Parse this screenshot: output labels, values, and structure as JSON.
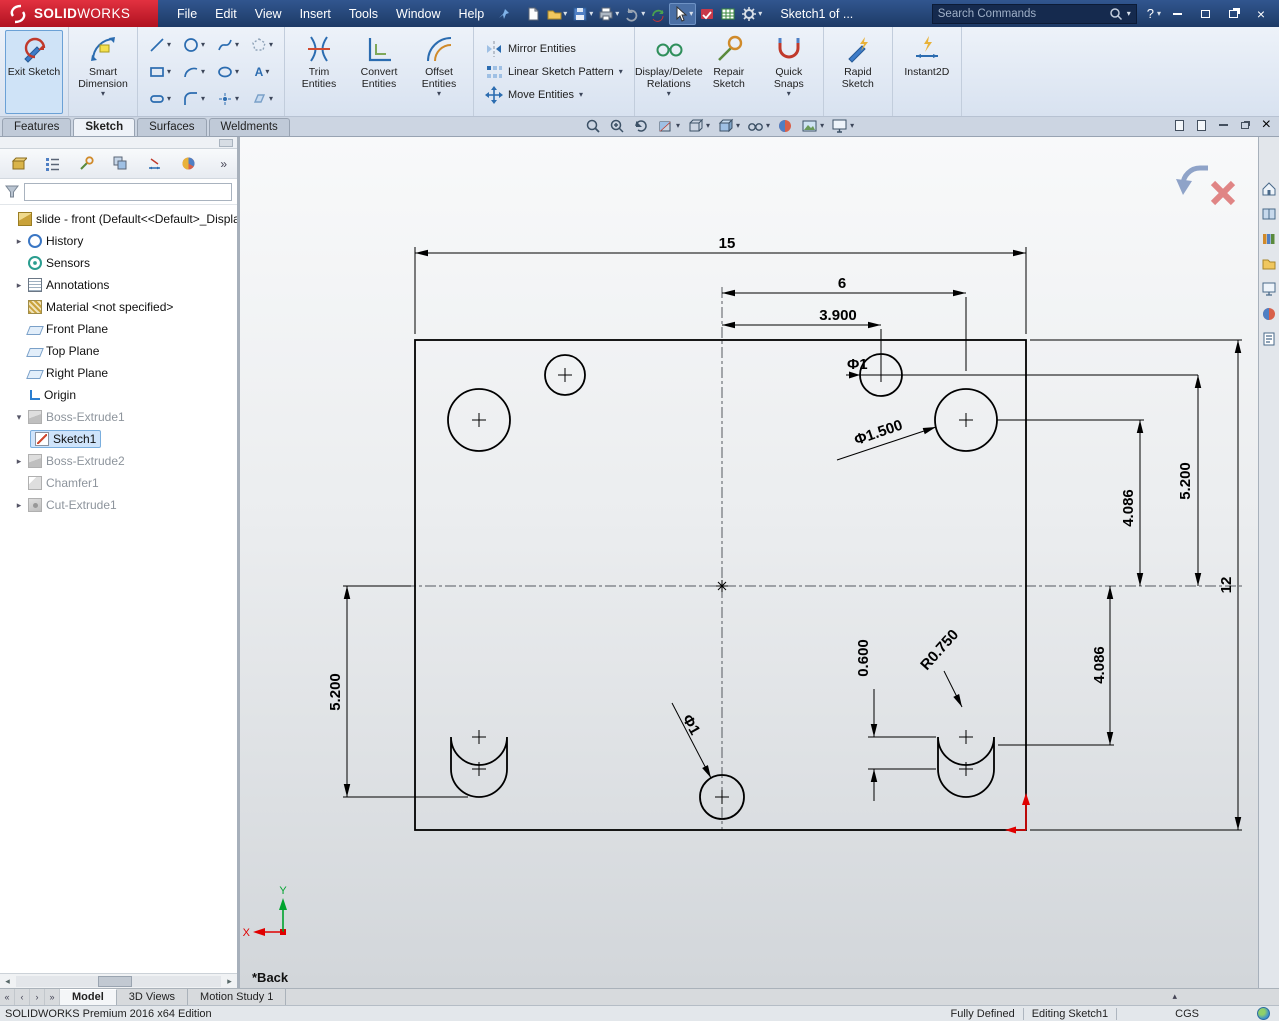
{
  "titlebar": {
    "logo_solid": "SOLID",
    "logo_works": "WORKS",
    "menus": [
      "File",
      "Edit",
      "View",
      "Insert",
      "Tools",
      "Window",
      "Help"
    ],
    "doc_title": "Sketch1 of ...",
    "search_placeholder": "Search Commands"
  },
  "ribbon": {
    "buttons": {
      "exit_sketch": "Exit Sketch",
      "smart_dimension": "Smart Dimension",
      "trim_entities": "Trim Entities",
      "convert_entities": "Convert Entities",
      "offset_entities": "Offset Entities",
      "mirror_entities": "Mirror Entities",
      "linear_pattern": "Linear Sketch Pattern",
      "move_entities": "Move Entities",
      "display_delete_relations": "Display/Delete Relations",
      "repair_sketch": "Repair Sketch",
      "quick_snaps": "Quick Snaps",
      "rapid_sketch": "Rapid Sketch",
      "instant2d": "Instant2D"
    }
  },
  "command_tabs": {
    "items": [
      "Features",
      "Sketch",
      "Surfaces",
      "Weldments"
    ],
    "active": "Sketch"
  },
  "feature_tree": {
    "root": "slide - front (Default<<Default>_Display",
    "filter_value": "",
    "items": [
      {
        "label": "History"
      },
      {
        "label": "Sensors"
      },
      {
        "label": "Annotations"
      },
      {
        "label": "Material <not specified>"
      },
      {
        "label": "Front Plane"
      },
      {
        "label": "Top Plane"
      },
      {
        "label": "Right Plane"
      },
      {
        "label": "Origin"
      },
      {
        "label": "Boss-Extrude1"
      },
      {
        "label": "Sketch1"
      },
      {
        "label": "Boss-Extrude2"
      },
      {
        "label": "Chamfer1"
      },
      {
        "label": "Cut-Extrude1"
      }
    ]
  },
  "sketch": {
    "view_label": "*Back",
    "triad": {
      "x": "X",
      "y": "Y"
    },
    "dims": {
      "overall_width": "15",
      "hole_spacing_6": "6",
      "hole_offset_3900": "3.900",
      "dia_1_top": "Φ1",
      "dia_1500": "Φ1.500",
      "right_5200": "5.200",
      "right_4086": "4.086",
      "overall_height": "12",
      "left_5200": "5.200",
      "dia_1_bottom": "Φ1",
      "slot_0600": "0.600",
      "radius_0750": "R0.750",
      "bottom_4086": "4.086"
    }
  },
  "bottom_tabs": {
    "items": [
      "Model",
      "3D Views",
      "Motion Study 1"
    ],
    "active": "Model"
  },
  "statusbar": {
    "edition": "SOLIDWORKS Premium 2016 x64 Edition",
    "defined_state": "Fully Defined",
    "editing": "Editing Sketch1",
    "units": "CGS"
  },
  "icons": {
    "dropdown": "▾",
    "help": "?",
    "close": "×",
    "chevrons": "»",
    "tree_collapsed": "▸",
    "tree_expanded": "▾",
    "scroll_left": "◂",
    "scroll_right": "▸",
    "nav_first": "«",
    "nav_prev": "‹",
    "nav_next": "›",
    "nav_last": "»",
    "text_tool": "A",
    "expand_up": "▴"
  }
}
